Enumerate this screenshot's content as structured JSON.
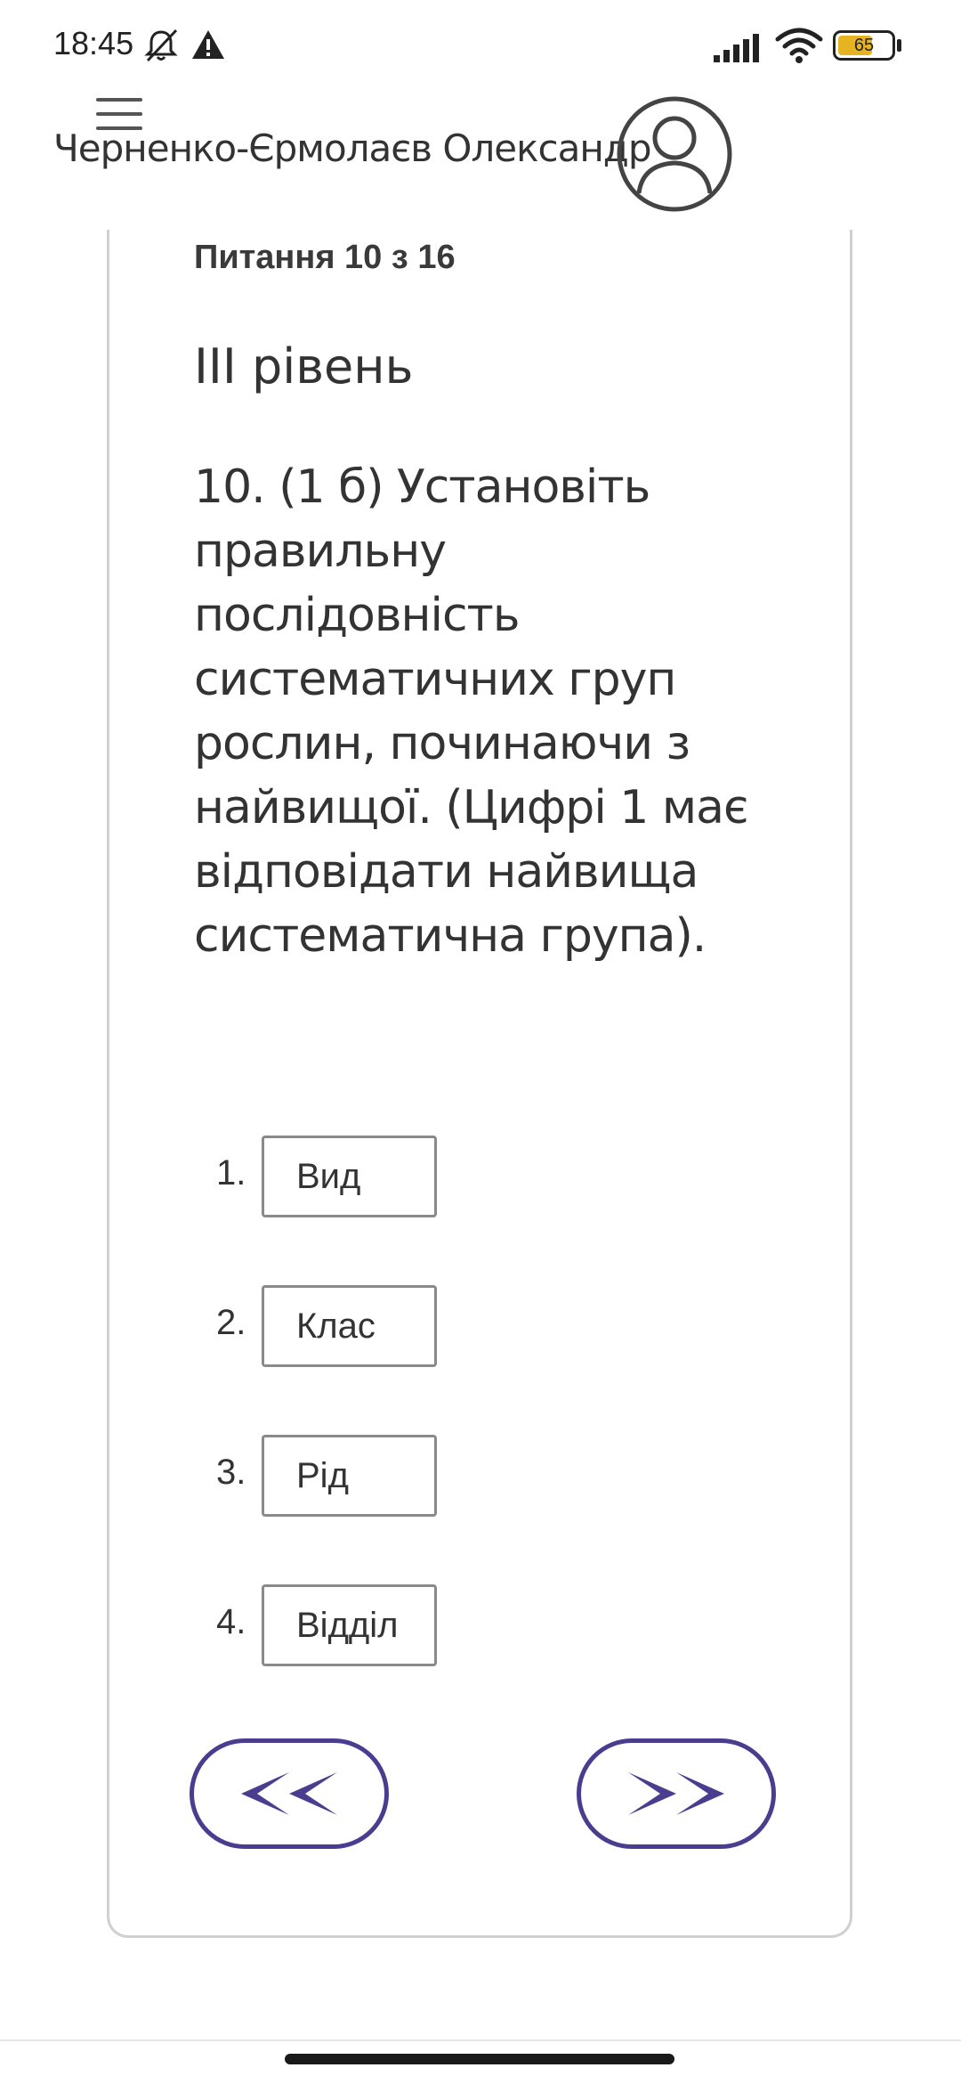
{
  "status_bar": {
    "time": "18:45",
    "battery_level": "65",
    "icons": [
      "bell-off-icon",
      "alert-icon",
      "signal-icon",
      "wifi-icon",
      "battery-icon"
    ]
  },
  "header": {
    "user_name": "Черненко-Єрмолаєв Олександр",
    "icons": [
      "menu-icon",
      "user-avatar-icon"
    ]
  },
  "quiz": {
    "counter": "Питання 10 з 16",
    "level": "ІІІ рівень",
    "question": "10. (1 б) Установіть правильну послідовність систематичних груп рослин, починаючи з найвищої. (Цифрі 1 має відповідати найвища систематична група).",
    "answers": [
      {
        "number": "1.",
        "value": "Вид"
      },
      {
        "number": "2.",
        "value": "Клас"
      },
      {
        "number": "3.",
        "value": "Рід"
      },
      {
        "number": "4.",
        "value": "Відділ"
      }
    ],
    "nav": {
      "prev_icon": "double-chevron-left-icon",
      "next_icon": "double-chevron-right-icon"
    }
  },
  "colors": {
    "accent": "#4a3d8f",
    "battery": "#e6b422",
    "card_border": "#d0d0d0"
  }
}
